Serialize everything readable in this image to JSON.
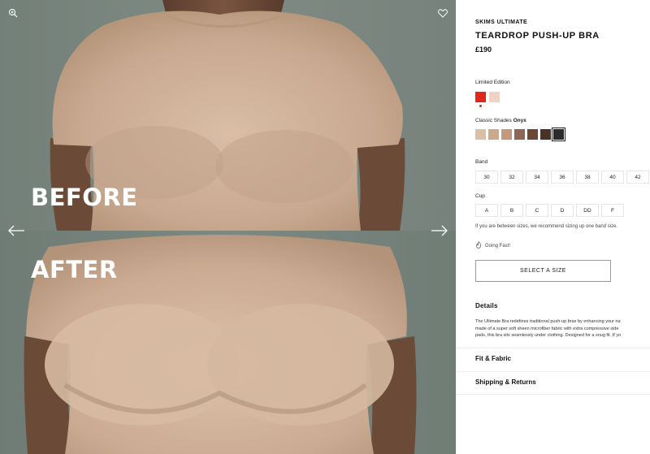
{
  "gallery": {
    "before_label": "BEFORE",
    "after_label": "AFTER",
    "icons": {
      "zoom": "zoom-icon",
      "wishlist": "heart-icon",
      "prev": "arrow-left-icon",
      "next": "arrow-right-icon"
    }
  },
  "product": {
    "brand": "SKIMS ULTIMATE",
    "title": "TEARDROP PUSH-UP BRA",
    "price": "£190"
  },
  "colors": {
    "limited_label": "Limited Edition",
    "limited_swatches": [
      "#e1261c",
      "#f1d3c6"
    ],
    "classic_label": "Classic Shades",
    "classic_selected": "Onyx",
    "classic_swatches": [
      "#ddbfa6",
      "#cda98c",
      "#c49a7e",
      "#8e6654",
      "#6c4839",
      "#4a3227",
      "#2c2b2b"
    ]
  },
  "band": {
    "label": "Band",
    "options": [
      "30",
      "32",
      "34",
      "36",
      "38",
      "40",
      "42"
    ]
  },
  "cup": {
    "label": "Cup",
    "options": [
      "A",
      "B",
      "C",
      "D",
      "DD",
      "F"
    ]
  },
  "size_hint": "If you are between sizes, we recommend sizing up one band size.",
  "stock_status": "Going Fast!",
  "cta_label": "SELECT A SIZE",
  "details": {
    "title": "Details",
    "lines": [
      "The Ultimate Bra redefines traditional push-up bras by enhancing your na",
      "made of a super soft sheen microfiber fabric with extra compressive side",
      "pads, this bra sits seamlessly under clothing. Designed for a snug fit. If yo"
    ]
  },
  "accordion": {
    "fit": "Fit & Fabric",
    "shipping": "Shipping & Returns"
  }
}
